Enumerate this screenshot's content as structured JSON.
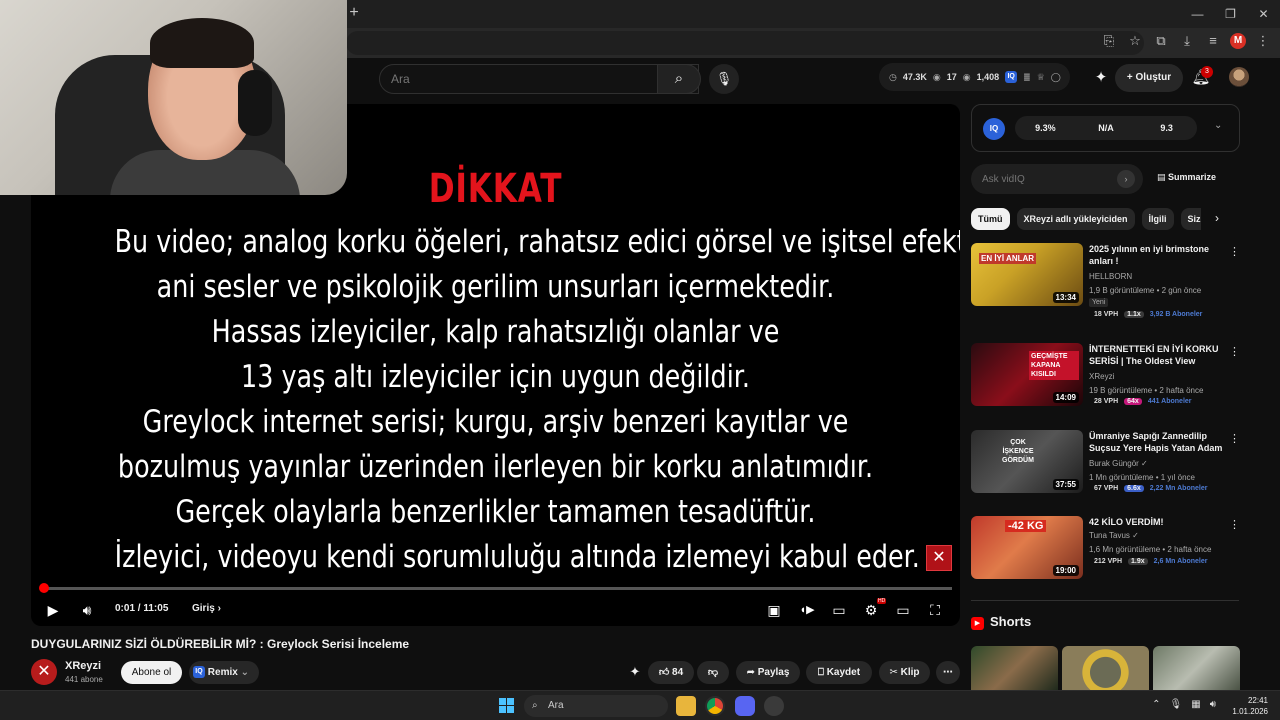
{
  "browser": {
    "window_controls": [
      "—",
      "❐",
      "✕"
    ],
    "profile_initial": "M"
  },
  "header": {
    "search_placeholder": "Ara",
    "stats": {
      "views": "47.3K",
      "watching": "17",
      "subs": "1,408"
    },
    "create_label": "Oluştur",
    "notifications_count": "3"
  },
  "player": {
    "warning_title": "DİKKAT",
    "warning_lines": [
      "Bu video; analog korku öğeleri, rahatsız edici görsel ve işitsel efektler,",
      "ani sesler ve psikolojik gerilim unsurları içermektedir.",
      "Hassas izleyiciler, kalp rahatsızlığı olanlar ve",
      "13 yaş altı izleyiciler için uygun değildir.",
      "Greylock internet serisi; kurgu, arşiv benzeri kayıtlar ve",
      "bozulmuş yayınlar üzerinden ilerleyen bir korku anlatımıdır.",
      "Gerçek olaylarla benzerlikler tamamen tesadüftür.",
      "İzleyici, videoyu kendi sorumluluğu altında izlemeyi kabul eder."
    ],
    "time": "0:01 / 11:05",
    "chapter": "Giriş",
    "progress_fraction": 0.0015,
    "hd_badge": "HD"
  },
  "video": {
    "title": "DUYGULARINIZ SİZİ ÖLDÜREBİLİR Mİ? : Greylock Serisi İnceleme",
    "channel": "XReyzi",
    "subscribers": "441 abone",
    "subscribe_label": "Abone ol",
    "remix_label": "Remix",
    "likes": "84",
    "share_label": "Paylaş",
    "save_label": "Kaydet",
    "clip_label": "Klip"
  },
  "vidiq": {
    "logo": "IQ",
    "metrics": [
      "9.3%",
      "N/A",
      "9.3"
    ],
    "ask_placeholder": "Ask vidIQ",
    "summarize_label": "Summarize"
  },
  "chips": [
    "Tümü",
    "XReyzi adlı yükleyiciden",
    "İlgili",
    "Sizin için"
  ],
  "recommendations": [
    {
      "title": "2025 yılının en iyi brimstone anları !",
      "channel": "HELLBORN",
      "meta": "1,9 B görüntüleme • 2 gün önce",
      "duration": "13:34",
      "badge": "Yeni",
      "vph": "18 VPH",
      "mult": "1.1x",
      "subs": "3,92 B Aboneler",
      "mult_color": "#3a3a3a",
      "thumb": "linear-gradient(135deg,#e8c23a 0%,#c9a126 40%,#6b4b12 100%)",
      "thumb_text": "EN İYİ  ANLAR"
    },
    {
      "title": "İNTERNETTEKİ EN İYİ KORKU SERİSİ | The Oldest View Türkçe",
      "channel": "XReyzi",
      "meta": "19 B görüntüleme • 2 hafta önce",
      "duration": "14:09",
      "vph": "28 VPH",
      "mult": "64x",
      "subs": "441 Aboneler",
      "mult_color": "#c4177a",
      "thumb": "linear-gradient(135deg,#2a0b10 0%,#8a0e1a 50%,#1a0508 100%)",
      "thumb_text": "GEÇMİŞTE KAPANA KISILDI"
    },
    {
      "title": "Ümraniye Sapığı Zannedilip Suçsuz Yere Hapis Yatan Adam",
      "channel": "Burak Güngör",
      "meta": "1 Mn görüntüleme • 1 yıl önce",
      "duration": "37:55",
      "vph": "67 VPH",
      "mult": "6.6x",
      "subs": "2,22 Mn Aboneler",
      "mult_color": "#3b5fc7",
      "thumb": "linear-gradient(135deg,#2b2b2b 0%,#555 50%,#1c1c1c 100%)",
      "thumb_text": "ÇOK İŞKENCE GÖRDÜM"
    },
    {
      "title": "42 KİLO VERDİM!",
      "channel": "Tuna Tavus",
      "meta": "1,6 Mn görüntüleme • 2 hafta önce",
      "duration": "19:00",
      "vph": "212 VPH",
      "mult": "1.9x",
      "subs": "2,6 Mn Aboneler",
      "mult_color": "#3a3a3a",
      "thumb": "linear-gradient(135deg,#c0392b 0%,#e07b4a 45%,#7a2e1e 100%)",
      "thumb_text": "-42 KG"
    }
  ],
  "shorts_label": "Shorts",
  "taskbar": {
    "search_label": "Ara",
    "time": "22:41",
    "date": "1.01.2026"
  }
}
